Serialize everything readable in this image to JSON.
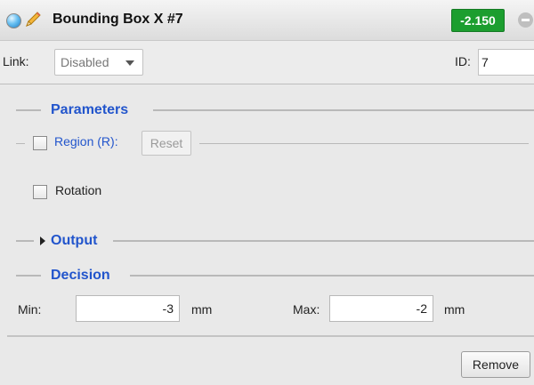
{
  "title_bar": {
    "title": "Bounding Box X #7",
    "score": "-2.150",
    "score_color": "#1c9e2f",
    "icons": [
      "status-dot-icon",
      "pencil-icon",
      "collapse-minus-icon"
    ]
  },
  "link_row": {
    "link_label": "Link:",
    "link_value": "Disabled",
    "id_label": "ID:",
    "id_value": "7"
  },
  "parameters": {
    "header": "Parameters",
    "region_label": "Region (R):",
    "region_checked": false,
    "reset_label": "Reset",
    "rotation_label": "Rotation",
    "rotation_checked": false
  },
  "output": {
    "header": "Output",
    "expanded": false
  },
  "decision": {
    "header": "Decision",
    "min_label": "Min:",
    "min_value": "-3",
    "min_unit": "mm",
    "max_label": "Max:",
    "max_value": "-2",
    "max_unit": "mm"
  },
  "footer": {
    "remove_label": "Remove"
  },
  "accent_color": "#2255cc"
}
